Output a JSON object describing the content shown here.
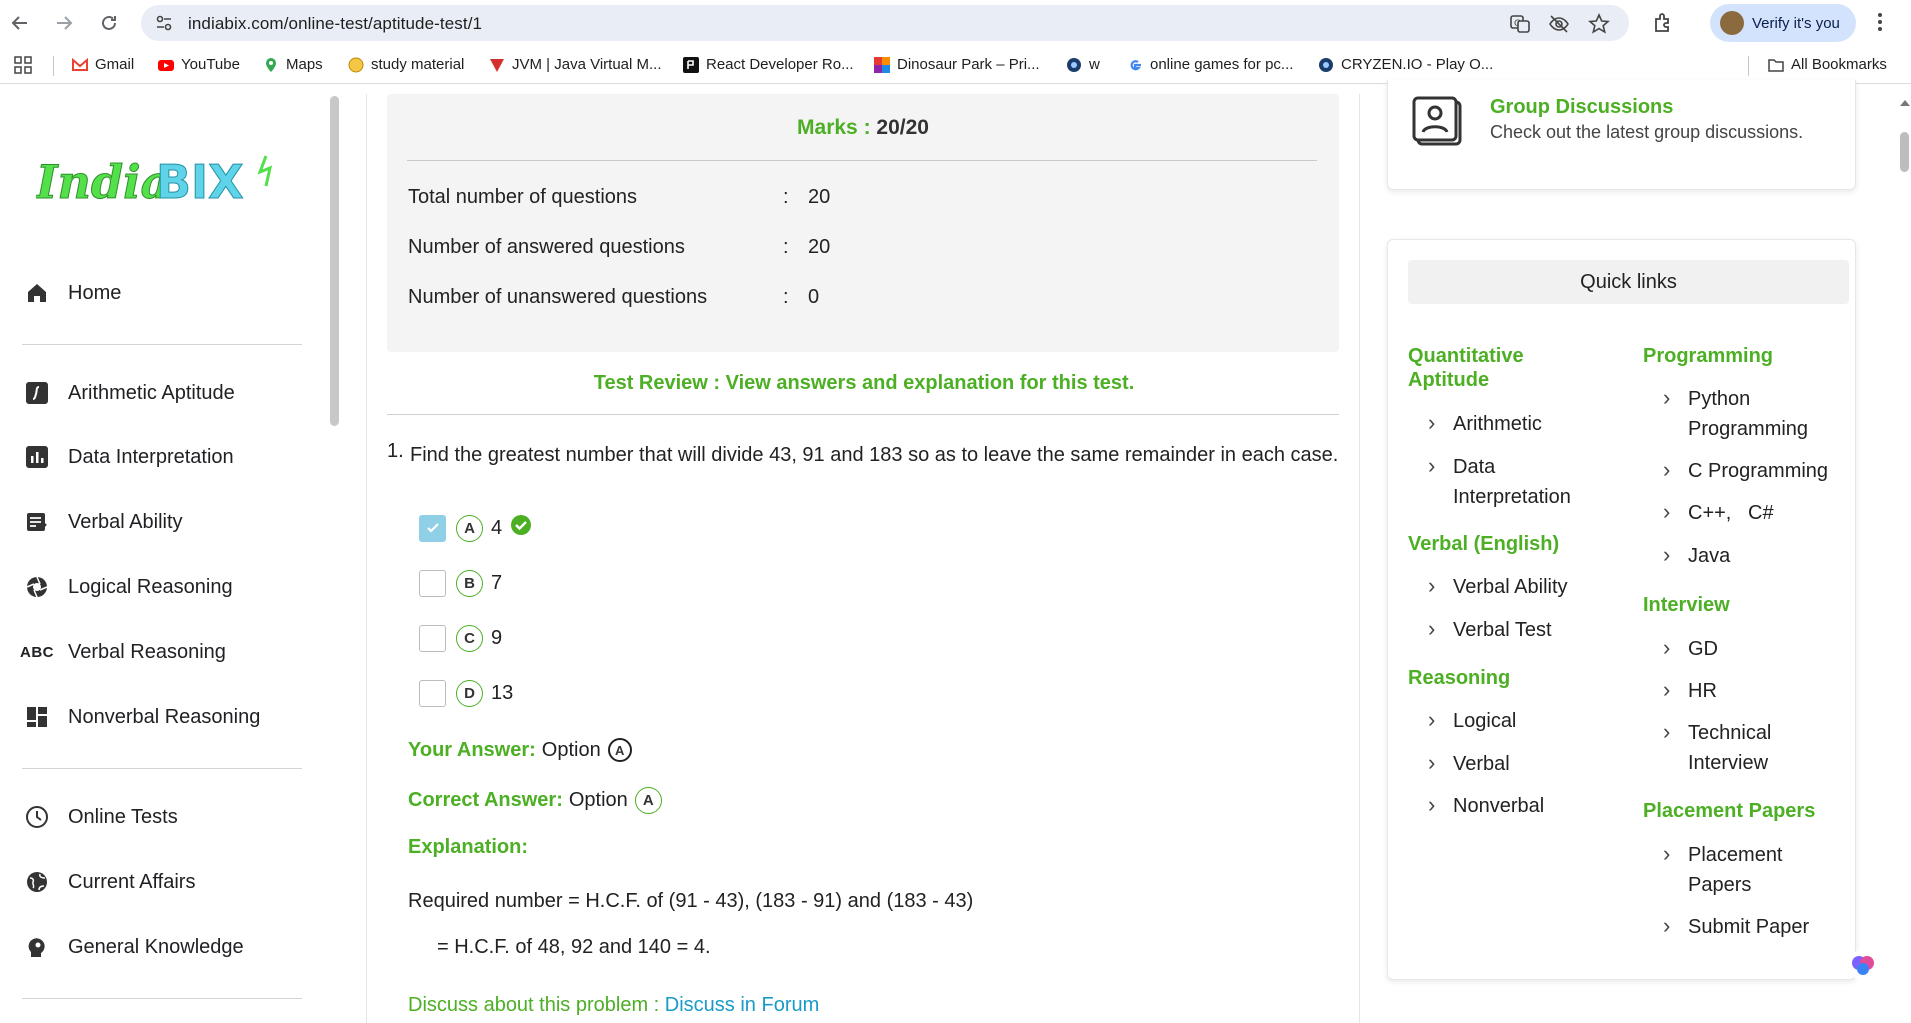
{
  "browser": {
    "url": "indiabix.com/online-test/aptitude-test/1",
    "profile_label": "Verify it's you",
    "bookmarks": [
      "Gmail",
      "YouTube",
      "Maps",
      "study material",
      "JVM | Java Virtual M...",
      "React Developer Ro...",
      "Dinosaur Park – Pri...",
      "w",
      "online games for pc...",
      "CRYZEN.IO - Play O..."
    ],
    "all_bookmarks": "All Bookmarks"
  },
  "sidebar": {
    "logo_text": "IndiaBIX",
    "primary": [
      {
        "label": "Home",
        "icon": "home-icon"
      }
    ],
    "sections": [
      {
        "label": "Arithmetic Aptitude",
        "icon": "function-icon"
      },
      {
        "label": "Data Interpretation",
        "icon": "bar-chart-icon"
      },
      {
        "label": "Verbal Ability",
        "icon": "checklist-icon"
      },
      {
        "label": "Logical Reasoning",
        "icon": "aperture-icon"
      },
      {
        "label": "Verbal Reasoning",
        "icon": "abc-icon"
      },
      {
        "label": "Nonverbal Reasoning",
        "icon": "dashboard-icon"
      }
    ],
    "extras": [
      {
        "label": "Online Tests",
        "icon": "clock-icon"
      },
      {
        "label": "Current Affairs",
        "icon": "globe-icon"
      },
      {
        "label": "General Knowledge",
        "icon": "head-icon"
      }
    ]
  },
  "result": {
    "marks_label": "Marks :",
    "marks_value": "20/20",
    "stats": [
      {
        "label": "Total number of questions",
        "value": "20"
      },
      {
        "label": "Number of answered questions",
        "value": "20"
      },
      {
        "label": "Number of unanswered questions",
        "value": "0"
      }
    ],
    "colon": ":",
    "review_text": "Test Review : View answers and explanation for this test."
  },
  "question": {
    "number": "1.",
    "text": "Find the greatest number that will divide 43, 91 and 183 so as to leave the same remainder in each case.",
    "options": [
      {
        "letter": "A",
        "value": "4",
        "checked": true
      },
      {
        "letter": "B",
        "value": "7",
        "checked": false
      },
      {
        "letter": "C",
        "value": "9",
        "checked": false
      },
      {
        "letter": "D",
        "value": "13",
        "checked": false
      }
    ],
    "your_answer_label": "Your Answer:",
    "your_answer_prefix": "Option",
    "your_answer_letter": "A",
    "correct_answer_label": "Correct Answer:",
    "correct_answer_prefix": "Option",
    "correct_answer_letter": "A",
    "explanation_label": "Explanation:",
    "explanation_line1": "Required number = H.C.F. of (91 - 43), (183 - 91) and (183 - 43)",
    "explanation_line2": "= H.C.F. of 48, 92 and 140 = 4.",
    "discuss_prefix": "Discuss about this problem :",
    "discuss_link": "Discuss in Forum"
  },
  "group_discussions": {
    "title": "Group Discussions",
    "subtitle": "Check out the latest group discussions."
  },
  "quick_links": {
    "heading": "Quick links",
    "left": {
      "quant_title": "Quantitative Aptitude",
      "quant_items": [
        "Arithmetic",
        "Data Interpretation"
      ],
      "verbal_title": "Verbal (English)",
      "verbal_items": [
        "Verbal Ability",
        "Verbal Test"
      ],
      "reasoning_title": "Reasoning",
      "reasoning_items": [
        "Logical",
        "Verbal",
        "Nonverbal"
      ]
    },
    "right": {
      "prog_title": "Programming",
      "prog_items": [
        "Python Programming",
        "C Programming",
        "C++,   C#",
        "Java"
      ],
      "interview_title": "Interview",
      "interview_items": [
        "GD",
        "HR",
        "Technical Interview"
      ],
      "papers_title": "Placement Papers",
      "papers_items": [
        "Placement Papers",
        "Submit Paper"
      ]
    }
  },
  "colors": {
    "accent_green": "#4caf24",
    "link_blue": "#1a9bc7"
  }
}
